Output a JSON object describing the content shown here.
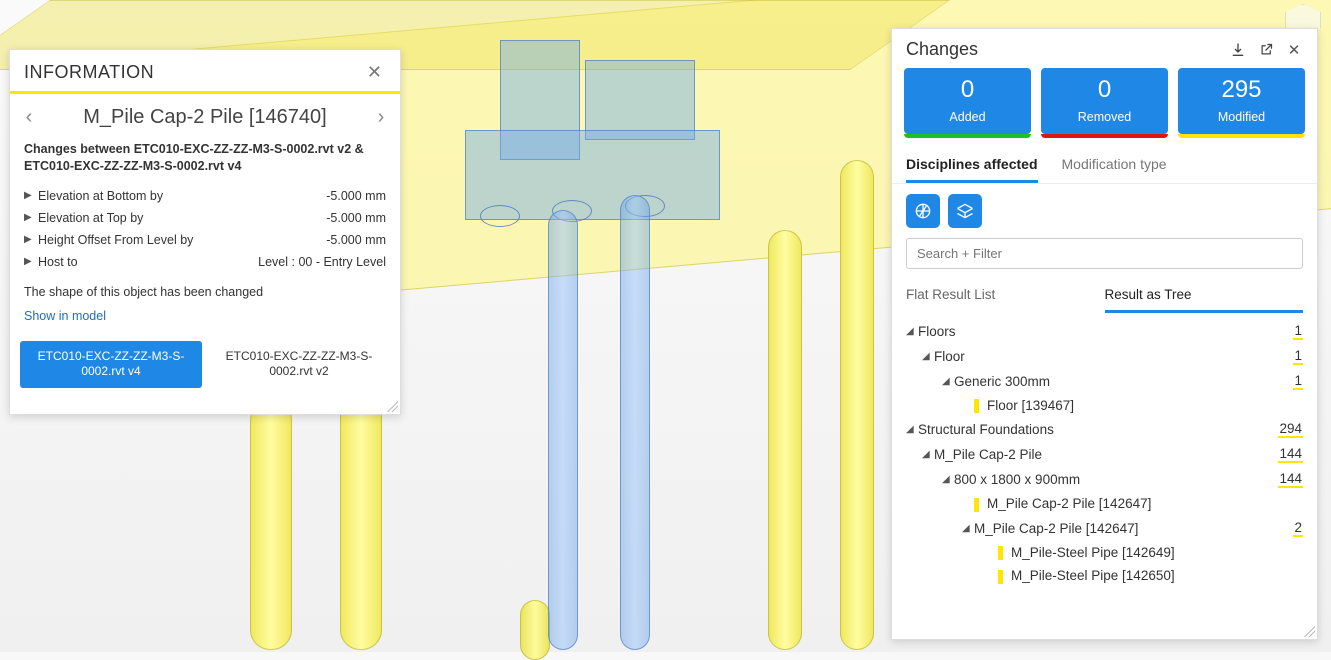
{
  "info": {
    "panel_title": "INFORMATION",
    "item_name": "M_Pile Cap-2 Pile [146740]",
    "changes_between": "Changes between ETC010-EXC-ZZ-ZZ-M3-S-0002.rvt v2 & ETC010-EXC-ZZ-ZZ-M3-S-0002.rvt v4",
    "props": [
      {
        "label": "Elevation at Bottom by",
        "value": "-5.000 mm"
      },
      {
        "label": "Elevation at Top by",
        "value": "-5.000 mm"
      },
      {
        "label": "Height Offset From Level by",
        "value": "-5.000 mm"
      },
      {
        "label": "Host to",
        "value": "Level : 00 - Entry Level"
      }
    ],
    "shape_note": "The shape of this object has been changed",
    "show_in_model": "Show in model",
    "file_v4": "ETC010-EXC-ZZ-ZZ-M3-S-0002.rvt v4",
    "file_v2": "ETC010-EXC-ZZ-ZZ-M3-S-0002.rvt v2"
  },
  "changes": {
    "title": "Changes",
    "stats": {
      "added": {
        "count": "0",
        "label": "Added"
      },
      "removed": {
        "count": "0",
        "label": "Removed"
      },
      "modified": {
        "count": "295",
        "label": "Modified"
      }
    },
    "subtabs": {
      "disciplines": "Disciplines affected",
      "modtype": "Modification type"
    },
    "search_placeholder": "Search + Filter",
    "result_tabs": {
      "flat": "Flat Result List",
      "tree": "Result as Tree"
    },
    "tree": [
      {
        "indent": 0,
        "twist": "◢",
        "label": "Floors",
        "count": "1"
      },
      {
        "indent": 1,
        "twist": "◢",
        "label": "Floor",
        "count": "1"
      },
      {
        "indent": 2,
        "twist": "◢",
        "label": "Generic 300mm",
        "count": "1"
      },
      {
        "indent": 3,
        "twist": "",
        "label": "Floor [139467]",
        "count": "",
        "mod": true
      },
      {
        "indent": 0,
        "twist": "◢",
        "label": "Structural Foundations",
        "count": "294"
      },
      {
        "indent": 1,
        "twist": "◢",
        "label": "M_Pile Cap-2 Pile",
        "count": "144"
      },
      {
        "indent": 2,
        "twist": "◢",
        "label": "800 x 1800 x 900mm",
        "count": "144"
      },
      {
        "indent": 3,
        "twist": "",
        "label": "M_Pile Cap-2 Pile [142647]",
        "count": "",
        "mod": true
      },
      {
        "indent": 3,
        "twist": "◢",
        "label": "M_Pile Cap-2 Pile [142647]",
        "count": "2"
      },
      {
        "indent": 4,
        "twist": "",
        "label": "M_Pile-Steel Pipe [142649]",
        "count": "",
        "mod": true
      },
      {
        "indent": 4,
        "twist": "",
        "label": "M_Pile-Steel Pipe [142650]",
        "count": "",
        "mod": true
      }
    ]
  }
}
